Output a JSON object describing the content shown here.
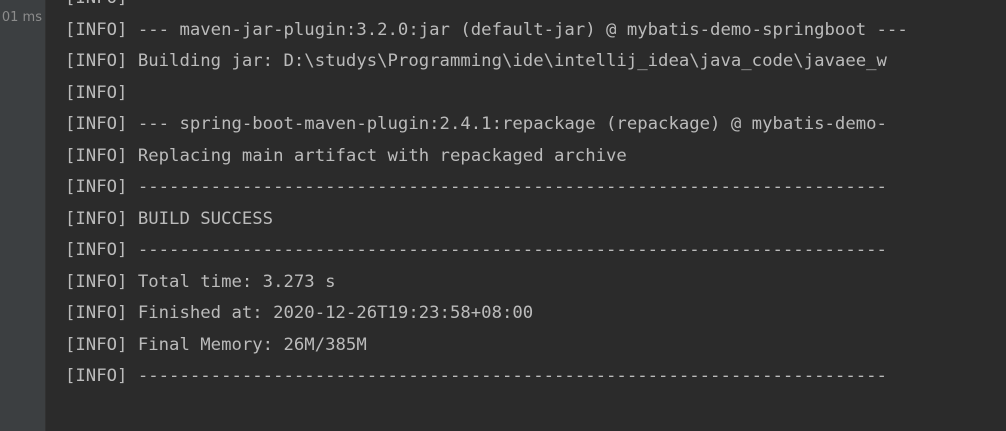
{
  "gutter": {
    "time_text": "01 ms"
  },
  "console": {
    "lines": [
      "[INFO]",
      "[INFO] --- maven-jar-plugin:3.2.0:jar (default-jar) @ mybatis-demo-springboot ---",
      "[INFO] Building jar: D:\\studys\\Programming\\ide\\intellij_idea\\java_code\\javaee_w",
      "[INFO]",
      "[INFO] --- spring-boot-maven-plugin:2.4.1:repackage (repackage) @ mybatis-demo-",
      "[INFO] Replacing main artifact with repackaged archive",
      "[INFO] ------------------------------------------------------------------------",
      "[INFO] BUILD SUCCESS",
      "[INFO] ------------------------------------------------------------------------",
      "[INFO] Total time: 3.273 s",
      "[INFO] Finished at: 2020-12-26T19:23:58+08:00",
      "[INFO] Final Memory: 26M/385M",
      "[INFO] ------------------------------------------------------------------------"
    ]
  },
  "colors": {
    "background": "#2b2b2b",
    "gutter": "#3c3f41",
    "text": "#bbbbbb",
    "gutter_text": "#8c8c8c"
  }
}
